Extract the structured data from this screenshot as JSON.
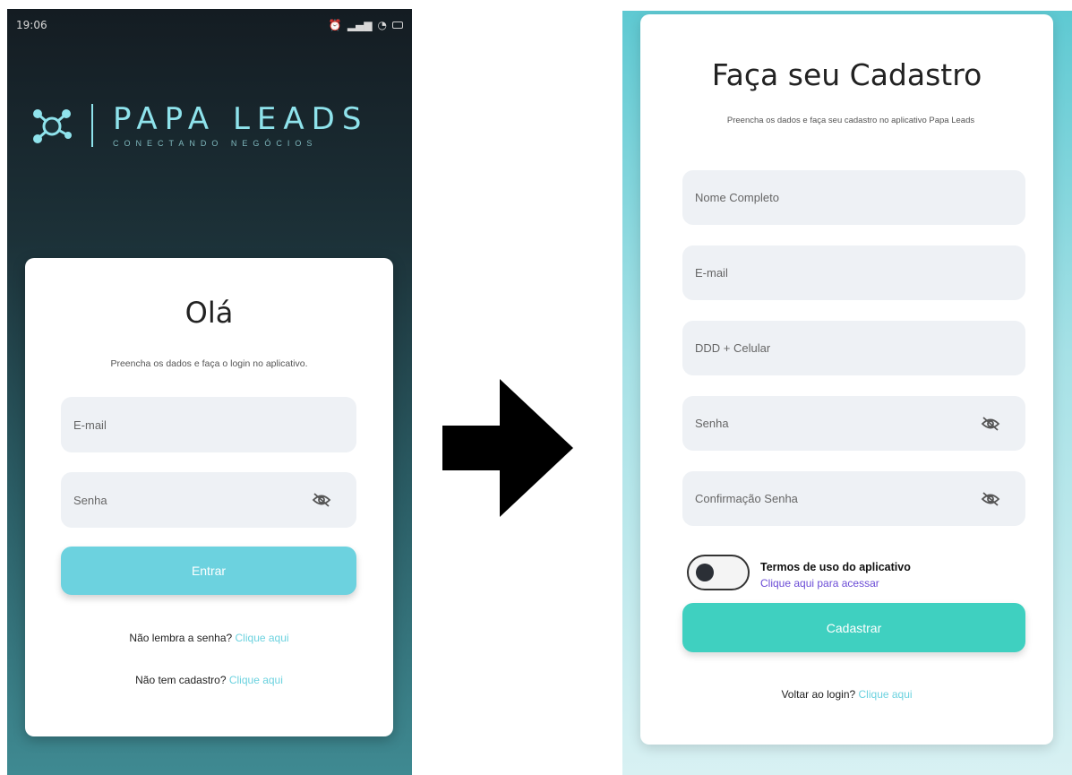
{
  "login_screen": {
    "status_bar": {
      "time": "19:06",
      "icons": [
        "alarm-icon",
        "signal-icon",
        "wifi-icon",
        "battery-icon"
      ]
    },
    "brand": {
      "name": "PAPA LEADS",
      "tagline": "CONECTANDO NEGÓCIOS"
    },
    "title": "Olá",
    "subtitle": "Preencha os dados e faça o login no aplicativo.",
    "email_placeholder": "E-mail",
    "password_placeholder": "Senha",
    "submit_label": "Entrar",
    "forgot_text": "Não lembra a senha?",
    "forgot_link": "Clique aqui",
    "register_text": "Não tem cadastro?",
    "register_link": "Clique aqui"
  },
  "register_screen": {
    "title": "Faça seu Cadastro",
    "subtitle": "Preencha os dados e faça seu cadastro no aplicativo Papa Leads",
    "fields": {
      "name_placeholder": "Nome Completo",
      "email_placeholder": "E-mail",
      "phone_placeholder": "DDD + Celular",
      "password_placeholder": "Senha",
      "confirm_placeholder": "Confirmação Senha"
    },
    "terms_label": "Termos de uso do aplicativo",
    "terms_link": "Clique aqui para acessar",
    "terms_accepted": false,
    "submit_label": "Cadastrar",
    "back_text": "Voltar ao login?",
    "back_link": "Clique aqui"
  },
  "colors": {
    "accent_login": "#6cd2df",
    "accent_register": "#3fd0c0",
    "terms_link": "#6b4cd6",
    "field_bg": "#eef1f5"
  }
}
